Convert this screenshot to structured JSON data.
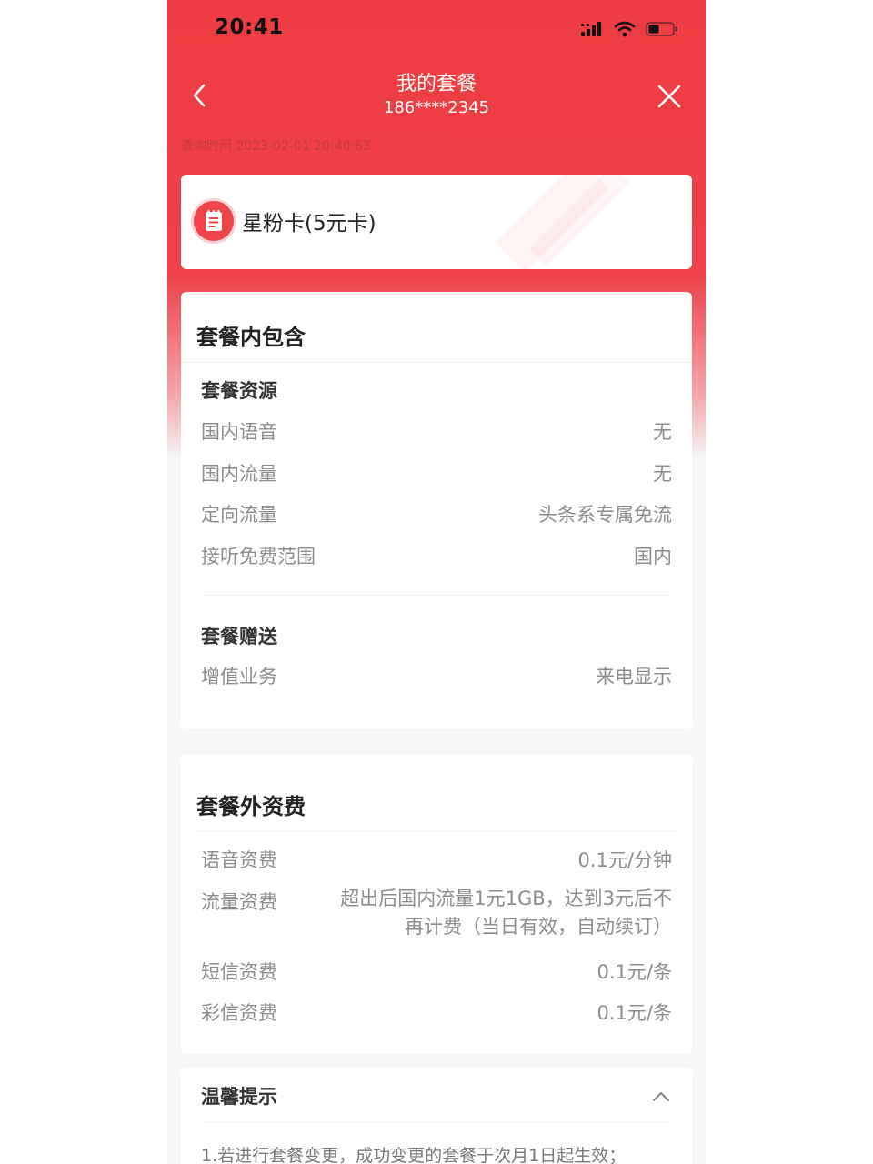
{
  "status_bar": {
    "time": "20:41",
    "icons": [
      "signal-icon",
      "wifi-icon",
      "battery-icon"
    ]
  },
  "nav": {
    "title": "我的套餐",
    "phone": "186****2345",
    "back_icon": "chevron-left-icon",
    "close_icon": "close-icon"
  },
  "query_time": "查询时间 2023-02-01 20:40:53",
  "plan": {
    "name": "星粉卡(5元卡)",
    "icon": "plan-document-icon"
  },
  "included": {
    "title": "套餐内包含",
    "resources": {
      "title": "套餐资源",
      "rows": [
        {
          "label": "国内语音",
          "value": "无"
        },
        {
          "label": "国内流量",
          "value": "无"
        },
        {
          "label": "定向流量",
          "value": "头条系专属免流"
        },
        {
          "label": "接听免费范围",
          "value": "国内"
        }
      ]
    },
    "gifts": {
      "title": "套餐赠送",
      "rows": [
        {
          "label": "增值业务",
          "value": "来电显示"
        }
      ]
    }
  },
  "extra_fees": {
    "title": "套餐外资费",
    "rows": [
      {
        "label": "语音资费",
        "value": "0.1元/分钟"
      },
      {
        "label": "流量资费",
        "value": "超出后国内流量1元1GB，达到3元后不再计费（当日有效，自动续订）"
      },
      {
        "label": "短信资费",
        "value": "0.1元/条"
      },
      {
        "label": "彩信资费",
        "value": "0.1元/条"
      }
    ]
  },
  "tips": {
    "title": "温馨提示",
    "collapse_icon": "chevron-up-icon",
    "items": [
      "1.若进行套餐变更，成功变更的套餐于次月1日起生效；"
    ]
  },
  "colors": {
    "brand": "#ee3d42",
    "background": "#f6f6f7",
    "text_primary": "#222222",
    "text_secondary": "#8c8c8c"
  }
}
